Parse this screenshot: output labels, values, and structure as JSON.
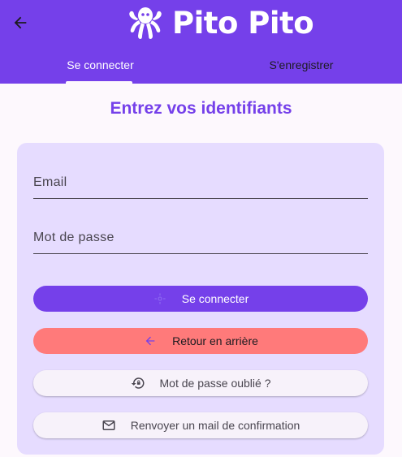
{
  "app": {
    "title": "Pito Pito"
  },
  "tabs": [
    {
      "label": "Se connecter",
      "active": true
    },
    {
      "label": "S'enregistrer",
      "active": false
    }
  ],
  "form": {
    "heading": "Entrez vos identifiants",
    "email": {
      "placeholder": "Email",
      "value": ""
    },
    "password": {
      "placeholder": "Mot de passe",
      "value": ""
    }
  },
  "buttons": {
    "login": {
      "label": "Se connecter",
      "icon": "login-icon"
    },
    "back": {
      "label": "Retour en arrière",
      "icon": "arrow-left-icon"
    },
    "forgot": {
      "label": "Mot de passe oublié ?",
      "icon": "lock-reset-icon"
    },
    "resend": {
      "label": "Renvoyer un mail de confirmation",
      "icon": "mail-icon"
    }
  },
  "colors": {
    "primary": "#7540ea",
    "card": "#e6dcff",
    "danger": "#ff7a7a",
    "background": "#fdf8fd"
  }
}
